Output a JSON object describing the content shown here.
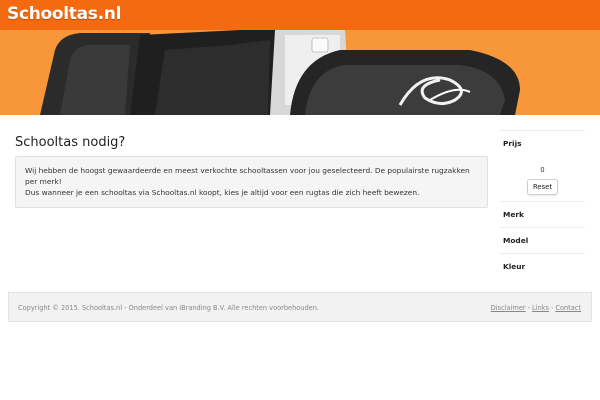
{
  "header": {
    "logo_text": "Schooltas.nl",
    "brand_color": "#f36a10",
    "banner_color": "#f7973a"
  },
  "main": {
    "title": "Schooltas nodig?",
    "intro_line1": "Wij hebben de hoogst gewaardeerde en meest verkochte schooltassen voor jou geselecteerd. De populairste rugzakken per merk!",
    "intro_line2": "Dus wanneer je een schooltas via Schooltas.nl koopt, kies je altijd voor een rugtas die zich heeft bewezen."
  },
  "sidebar": {
    "filters": [
      {
        "label": "Prijs"
      },
      {
        "label": "Merk"
      },
      {
        "label": "Model"
      },
      {
        "label": "Kleur"
      }
    ],
    "price_value": "0",
    "reset_label": "Reset"
  },
  "footer": {
    "copyright": "Copyright © 2015.  Schooltas.nl - Onderdeel van iBranding B.V.  Alle rechten voorbehouden.",
    "links": [
      "Disclaimer",
      "Links",
      "Contact"
    ],
    "separator": "-"
  }
}
